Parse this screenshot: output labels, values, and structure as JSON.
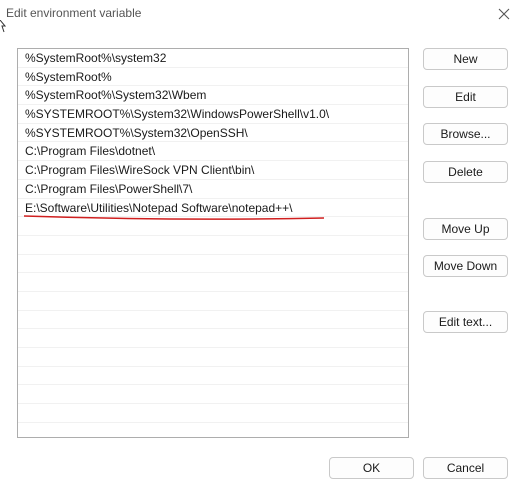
{
  "dialog": {
    "title": "Edit environment variable"
  },
  "paths": [
    "%SystemRoot%\\system32",
    "%SystemRoot%",
    "%SystemRoot%\\System32\\Wbem",
    "%SYSTEMROOT%\\System32\\WindowsPowerShell\\v1.0\\",
    "%SYSTEMROOT%\\System32\\OpenSSH\\",
    "C:\\Program Files\\dotnet\\",
    "C:\\Program Files\\WireSock VPN Client\\bin\\",
    "C:\\Program Files\\PowerShell\\7\\",
    "E:\\Software\\Utilities\\Notepad Software\\notepad++\\"
  ],
  "buttons": {
    "new": "New",
    "edit": "Edit",
    "browse": "Browse...",
    "delete": "Delete",
    "move_up": "Move Up",
    "move_down": "Move Down",
    "edit_text": "Edit text...",
    "ok": "OK",
    "cancel": "Cancel"
  },
  "colors": {
    "underline": "#d01f1f"
  },
  "icons": {
    "close": "close-icon"
  }
}
